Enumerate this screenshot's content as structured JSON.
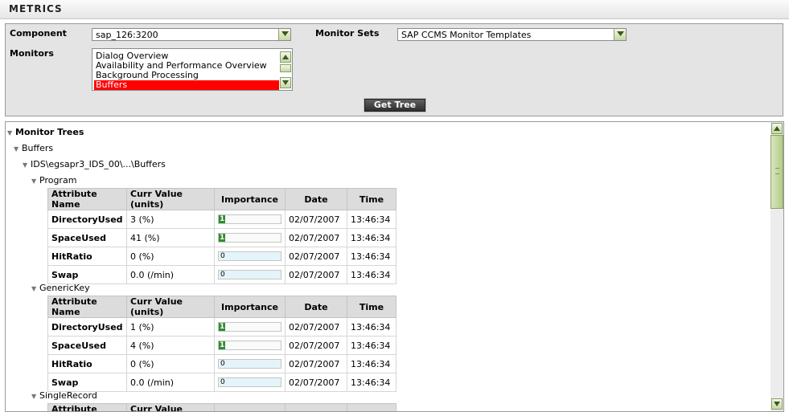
{
  "header": {
    "title": "METRICS"
  },
  "form": {
    "component_label": "Component",
    "component_value": "sap_126:3200",
    "monitor_sets_label": "Monitor Sets",
    "monitor_sets_value": "SAP CCMS Monitor Templates",
    "monitors_label": "Monitors",
    "monitors": [
      {
        "label": "Dialog Overview",
        "selected": false
      },
      {
        "label": "Availability and Performance Overview",
        "selected": false
      },
      {
        "label": "Background Processing",
        "selected": false
      },
      {
        "label": "Buffers",
        "selected": true
      }
    ],
    "get_tree_label": "Get Tree"
  },
  "tree": {
    "root": "Monitor Trees",
    "level1": "Buffers",
    "level2": "IDS\\egsapr3_IDS_00\\...\\Buffers",
    "columns": [
      "Attribute Name",
      "Curr Value (units)",
      "Importance",
      "Date",
      "Time"
    ],
    "groups": [
      {
        "name": "Program",
        "rows": [
          {
            "attr": "DirectoryUsed",
            "value": "3 (%)",
            "importance": "1",
            "date": "02/07/2007",
            "time": "13:46:34"
          },
          {
            "attr": "SpaceUsed",
            "value": "41 (%)",
            "importance": "1",
            "date": "02/07/2007",
            "time": "13:46:34"
          },
          {
            "attr": "HitRatio",
            "value": "0 (%)",
            "importance": "0",
            "date": "02/07/2007",
            "time": "13:46:34"
          },
          {
            "attr": "Swap",
            "value": "0.0 (/min)",
            "importance": "0",
            "date": "02/07/2007",
            "time": "13:46:34"
          }
        ]
      },
      {
        "name": "GenericKey",
        "rows": [
          {
            "attr": "DirectoryUsed",
            "value": "1 (%)",
            "importance": "1",
            "date": "02/07/2007",
            "time": "13:46:34"
          },
          {
            "attr": "SpaceUsed",
            "value": "4 (%)",
            "importance": "1",
            "date": "02/07/2007",
            "time": "13:46:34"
          },
          {
            "attr": "HitRatio",
            "value": "0 (%)",
            "importance": "0",
            "date": "02/07/2007",
            "time": "13:46:34"
          },
          {
            "attr": "Swap",
            "value": "0.0 (/min)",
            "importance": "0",
            "date": "02/07/2007",
            "time": "13:46:34"
          }
        ]
      },
      {
        "name": "SingleRecord",
        "rows": []
      }
    ]
  }
}
